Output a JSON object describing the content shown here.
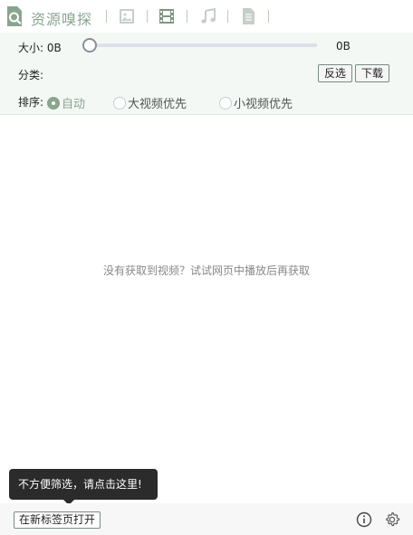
{
  "header": {
    "title": "资源嗅探",
    "tabs": [
      {
        "name": "image",
        "icon": "image-icon"
      },
      {
        "name": "video",
        "icon": "film-icon"
      },
      {
        "name": "audio",
        "icon": "music-note-icon"
      },
      {
        "name": "document",
        "icon": "document-icon"
      }
    ],
    "accent_color": "#8aa58f"
  },
  "filters": {
    "size_label": "大小:",
    "size_min": "0B",
    "size_max": "0B",
    "category_label": "分类:",
    "invert_button": "反选",
    "download_button": "下载",
    "sort_label": "排序:",
    "sort_options": [
      {
        "label": "自动",
        "checked": true
      },
      {
        "label": "大视频优先",
        "checked": false
      },
      {
        "label": "小视频优先",
        "checked": false
      }
    ]
  },
  "main": {
    "empty_message": "没有获取到视频？试试网页中播放后再获取"
  },
  "tooltip": {
    "text": "不方便筛选，请点击这里!"
  },
  "footer": {
    "open_in_tab_button": "在新标签页打开",
    "info_icon": "info-icon",
    "settings_icon": "gear-icon"
  }
}
